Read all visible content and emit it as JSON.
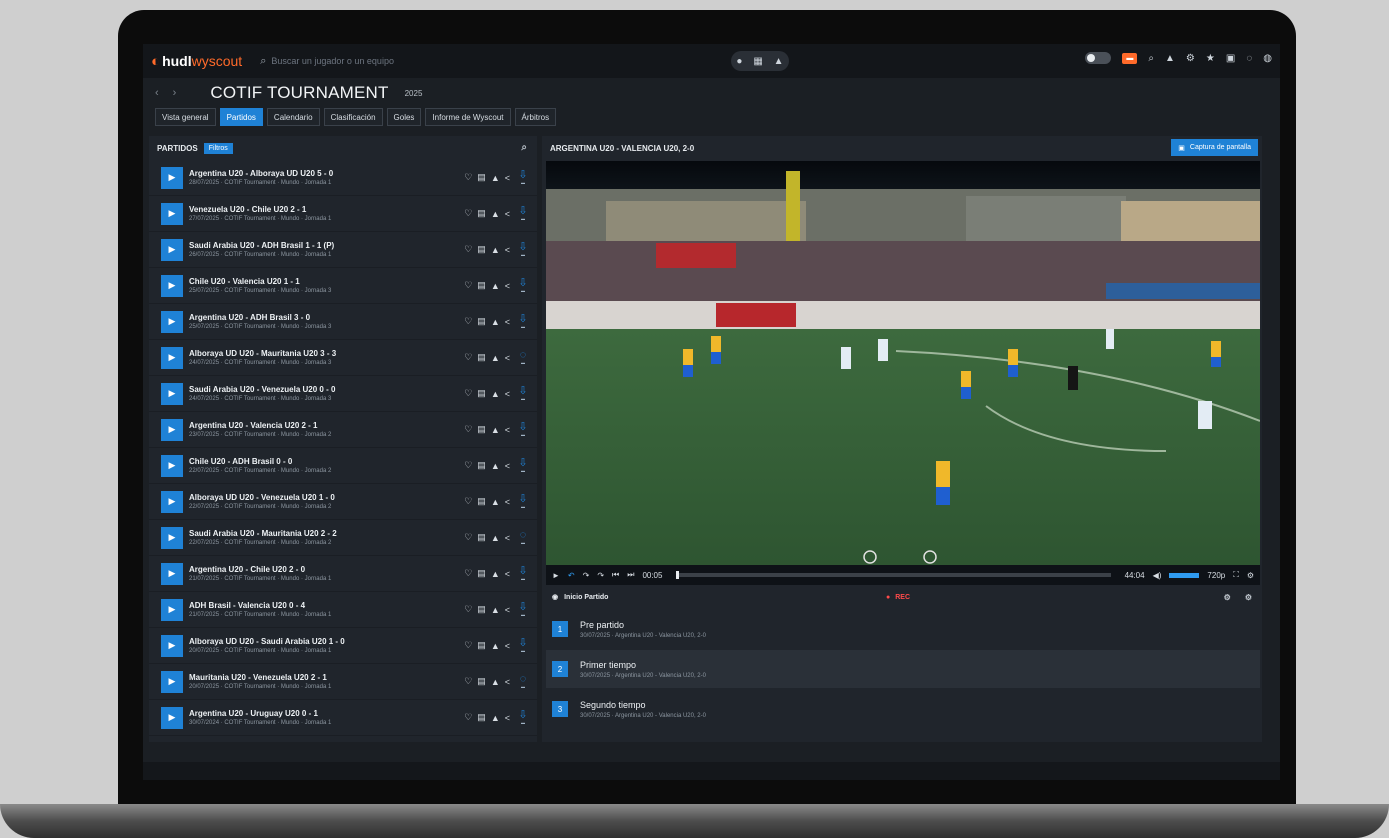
{
  "app": {
    "brand": "hudl",
    "brand_sub": "wyscout"
  },
  "search": {
    "placeholder": "Buscar un jugador o un equipo"
  },
  "titlebar": {
    "title": "COTIF TOURNAMENT",
    "year": "2025"
  },
  "tabs": [
    {
      "label": "Vista general"
    },
    {
      "label": "Partidos",
      "active": true
    },
    {
      "label": "Calendario"
    },
    {
      "label": "Clasificación"
    },
    {
      "label": "Goles"
    },
    {
      "label": "Informe de Wyscout"
    },
    {
      "label": "Árbitros"
    }
  ],
  "left": {
    "heading": "PARTIDOS",
    "filter_label": "Filtros"
  },
  "matches": [
    {
      "title": "Argentina U20 - Alboraya UD U20 5 - 0",
      "meta": "28/07/2025 · COTIF Tournament · Mundo · Jornada 1",
      "dl": "download"
    },
    {
      "title": "Venezuela U20 - Chile U20 2 - 1",
      "meta": "27/07/2025 · COTIF Tournament · Mundo · Jornada 1",
      "dl": "download"
    },
    {
      "title": "Saudi Arabia U20 - ADH Brasil 1 - 1 (P)",
      "meta": "26/07/2025 · COTIF Tournament · Mundo · Jornada 1",
      "dl": "download"
    },
    {
      "title": "Chile U20 - Valencia U20 1 - 1",
      "meta": "25/07/2025 · COTIF Tournament · Mundo · Jornada 3",
      "dl": "download"
    },
    {
      "title": "Argentina U20 - ADH Brasil 3 - 0",
      "meta": "25/07/2025 · COTIF Tournament · Mundo · Jornada 3",
      "dl": "download"
    },
    {
      "title": "Alboraya UD U20 - Mauritania U20 3 - 3",
      "meta": "24/07/2025 · COTIF Tournament · Mundo · Jornada 3",
      "dl": "pending"
    },
    {
      "title": "Saudi Arabia U20 - Venezuela U20 0 - 0",
      "meta": "24/07/2025 · COTIF Tournament · Mundo · Jornada 3",
      "dl": "download"
    },
    {
      "title": "Argentina U20 - Valencia U20 2 - 1",
      "meta": "23/07/2025 · COTIF Tournament · Mundo · Jornada 2",
      "dl": "download"
    },
    {
      "title": "Chile U20 - ADH Brasil 0 - 0",
      "meta": "22/07/2025 · COTIF Tournament · Mundo · Jornada 2",
      "dl": "download"
    },
    {
      "title": "Alboraya UD U20 - Venezuela U20 1 - 0",
      "meta": "22/07/2025 · COTIF Tournament · Mundo · Jornada 2",
      "dl": "download"
    },
    {
      "title": "Saudi Arabia U20 - Mauritania U20 2 - 2",
      "meta": "22/07/2025 · COTIF Tournament · Mundo · Jornada 2",
      "dl": "pending"
    },
    {
      "title": "Argentina U20 - Chile U20 2 - 0",
      "meta": "21/07/2025 · COTIF Tournament · Mundo · Jornada 1",
      "dl": "download"
    },
    {
      "title": "ADH Brasil - Valencia U20 0 - 4",
      "meta": "21/07/2025 · COTIF Tournament · Mundo · Jornada 1",
      "dl": "download"
    },
    {
      "title": "Alboraya UD U20 - Saudi Arabia U20 1 - 0",
      "meta": "20/07/2025 · COTIF Tournament · Mundo · Jornada 1",
      "dl": "download"
    },
    {
      "title": "Mauritania U20 - Venezuela U20 2 - 1",
      "meta": "20/07/2025 · COTIF Tournament · Mundo · Jornada 1",
      "dl": "pending"
    },
    {
      "title": "Argentina U20 - Uruguay U20 0 - 1",
      "meta": "30/07/2024 · COTIF Tournament · Mundo · Jornada 1",
      "dl": "download"
    }
  ],
  "right": {
    "heading": "ARGENTINA U20 - VALENCIA U20, 2-0",
    "capture_label": "Captura de pantalla"
  },
  "player": {
    "time_current": "00:05",
    "time_total": "44:04",
    "quality": "720p"
  },
  "events": {
    "heading": "Inicio Partido",
    "live_label": "REC",
    "items": [
      {
        "badge": "1",
        "title": "Pre partido",
        "meta": "30/07/2025 · Argentina U20 - Valencia U20, 2-0"
      },
      {
        "badge": "2",
        "title": "Primer tiempo",
        "meta": "30/07/2025 · Argentina U20 - Valencia U20, 2-0"
      },
      {
        "badge": "3",
        "title": "Segundo tiempo",
        "meta": "30/07/2025 · Argentina U20 - Valencia U20, 2-0"
      }
    ]
  },
  "colors": {
    "accent": "#1f82d6",
    "brand": "#ff6a2a",
    "rec": "#ff4a4a"
  }
}
